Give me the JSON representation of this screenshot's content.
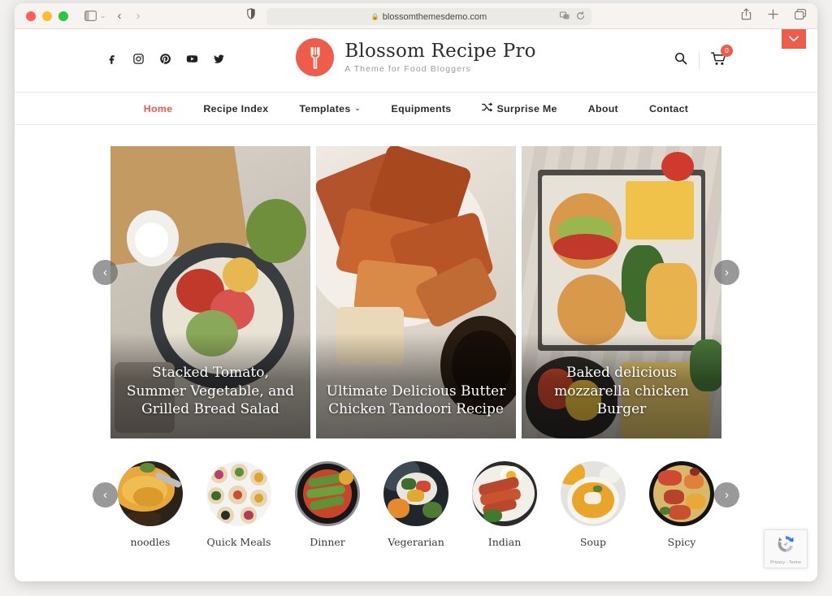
{
  "browser": {
    "url": "blossomthemesdemo.com",
    "lock_icon": "lock-icon",
    "reload_icon": "reload-icon",
    "extensions_icon": "extensions-icon",
    "share_icon": "share-icon",
    "new_tab_icon": "plus-icon",
    "tabs_icon": "tab-overview-icon",
    "sidebar_icon": "sidebar-toggle-icon",
    "back_icon": "back-chevron-icon",
    "forward_icon": "forward-chevron-icon",
    "shield_icon": "privacy-shield-icon"
  },
  "site": {
    "brand": {
      "title": "Blossom Recipe Pro",
      "tagline": "A Theme for Food Bloggers",
      "logo_icon": "fork-logo-icon",
      "logo_color": "#ee5d4a"
    },
    "socials": [
      {
        "name": "facebook-icon",
        "label": "Facebook"
      },
      {
        "name": "instagram-icon",
        "label": "Instagram"
      },
      {
        "name": "pinterest-icon",
        "label": "Pinterest"
      },
      {
        "name": "youtube-icon",
        "label": "YouTube"
      },
      {
        "name": "twitter-icon",
        "label": "Twitter"
      }
    ],
    "actions": {
      "search_icon": "search-icon",
      "cart_icon": "cart-icon",
      "cart_count": "0",
      "expand_label": "⌄"
    },
    "nav": [
      {
        "label": "Home",
        "active": true,
        "caret": ""
      },
      {
        "label": "Recipe Index",
        "active": false,
        "caret": ""
      },
      {
        "label": "Templates",
        "active": false,
        "caret": "⌄"
      },
      {
        "label": "Equipments",
        "active": false,
        "caret": ""
      },
      {
        "label": "Surprise Me",
        "active": false,
        "caret": "",
        "icon": "shuffle-icon"
      },
      {
        "label": "About",
        "active": false,
        "caret": ""
      },
      {
        "label": "Contact",
        "active": false,
        "caret": ""
      }
    ],
    "slider": {
      "prev_label": "‹",
      "next_label": "›",
      "slides": [
        {
          "caption": "Stacked Tomato, Summer Vegetable, and Grilled Bread Salad"
        },
        {
          "caption": "Ultimate Delicious Butter Chicken Tandoori Recipe"
        },
        {
          "caption": "Baked delicious mozzarella chicken Burger"
        }
      ]
    },
    "categories": {
      "prev_label": "‹",
      "next_label": "›",
      "items": [
        {
          "label": "noodles"
        },
        {
          "label": "Quick Meals"
        },
        {
          "label": "Dinner"
        },
        {
          "label": "Vegerarian"
        },
        {
          "label": "Indian"
        },
        {
          "label": "Soup"
        },
        {
          "label": "Spicy"
        }
      ]
    },
    "recaptcha": {
      "privacy": "Privacy",
      "sep": "-",
      "terms": "Terms"
    }
  }
}
